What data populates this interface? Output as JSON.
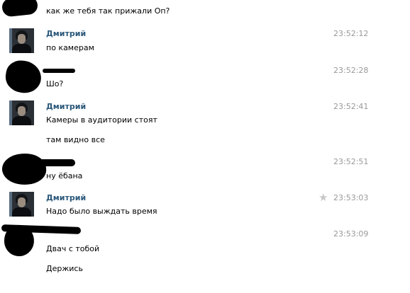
{
  "messages": [
    {
      "id": 0,
      "author": "",
      "time": "",
      "lines": [
        "как же тебя так прижали Оп?"
      ]
    },
    {
      "id": 1,
      "author": "Дмитрий",
      "time": "23:52:12",
      "lines": [
        "по камерам"
      ]
    },
    {
      "id": 2,
      "author": "",
      "time": "23:52:28",
      "lines": [
        "Шо?"
      ]
    },
    {
      "id": 3,
      "author": "Дмитрий",
      "time": "23:52:41",
      "lines": [
        "Камеры в аудитории стоят",
        "там видно все"
      ]
    },
    {
      "id": 4,
      "author": "",
      "time": "23:52:51",
      "lines": [
        "ну ёбана"
      ]
    },
    {
      "id": 5,
      "author": "Дмитрий",
      "time": "23:53:03",
      "lines": [
        "Надо было выждать время"
      ],
      "star_icon": "star-icon"
    },
    {
      "id": 6,
      "author": "",
      "time": "23:53:09",
      "lines": [
        "Двач с тобой",
        "Держись"
      ]
    }
  ],
  "colors": {
    "author_name": "#2b587a",
    "timestamp": "#999999",
    "star": "#c7c7c7"
  }
}
